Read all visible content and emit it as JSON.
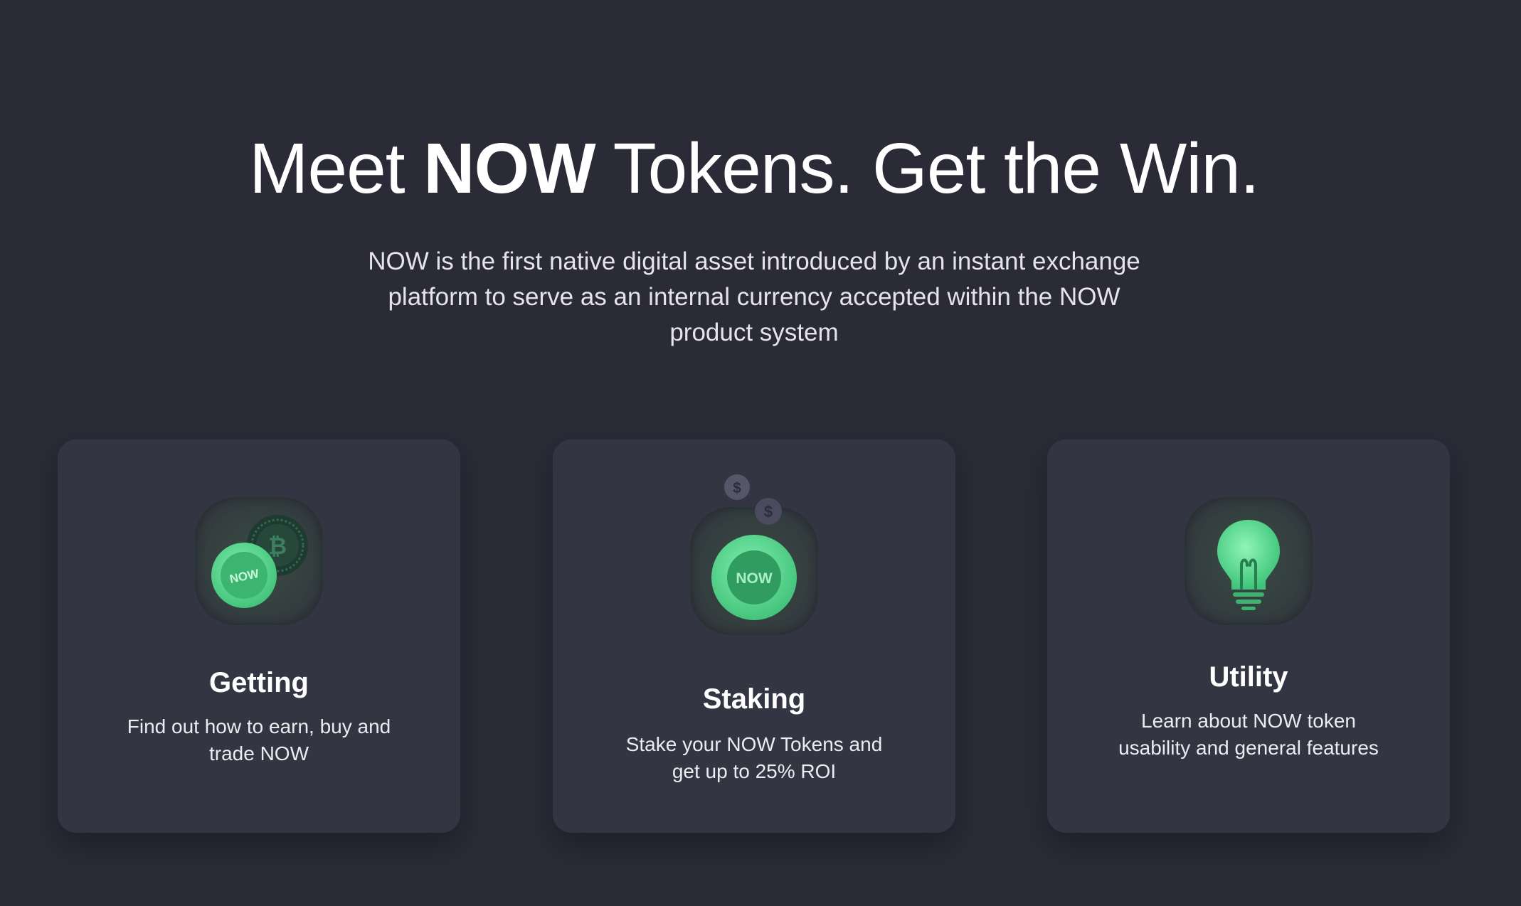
{
  "hero": {
    "title_pre": "Meet ",
    "title_bold": "NOW",
    "title_post": " Tokens. Get the Win.",
    "subtitle": "NOW is the first native digital asset introduced by an instant exchange platform to serve as an internal currency accepted within the NOW product system"
  },
  "cards": [
    {
      "icon": "coins-icon",
      "title": "Getting",
      "description": "Find out how to earn, buy and trade NOW",
      "coin_label": "NOW"
    },
    {
      "icon": "staking-coin-icon",
      "title": "Staking",
      "description": "Stake your NOW Tokens and get up to 25% ROI",
      "coin_label": "NOW"
    },
    {
      "icon": "lightbulb-icon",
      "title": "Utility",
      "description": "Learn about NOW token usability and general features"
    }
  ],
  "colors": {
    "background": "#2a2b37",
    "card": "#343542",
    "accent_green": "#4fd08a",
    "text": "#ffffff"
  }
}
